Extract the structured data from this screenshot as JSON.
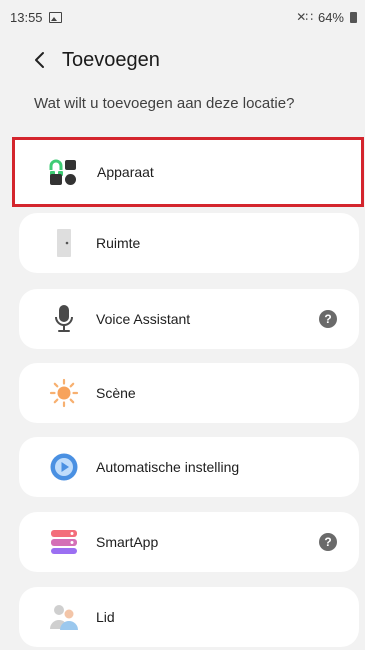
{
  "status_bar": {
    "time": "13:55",
    "signal": "✕∷",
    "battery": "64%"
  },
  "header": {
    "title": "Toevoegen"
  },
  "prompt": "Wat wilt u toevoegen aan deze locatie?",
  "items": [
    {
      "label": "Apparaat",
      "icon": "device-icon",
      "help": false,
      "selected": true
    },
    {
      "label": "Ruimte",
      "icon": "room-door-icon",
      "help": false
    },
    {
      "label": "Voice Assistant",
      "icon": "microphone-icon",
      "help": true
    },
    {
      "label": "Scène",
      "icon": "sun-scene-icon",
      "help": false
    },
    {
      "label": "Automatische instelling",
      "icon": "automation-play-icon",
      "help": false
    },
    {
      "label": "SmartApp",
      "icon": "smartapp-icon",
      "help": true
    },
    {
      "label": "Lid",
      "icon": "members-icon",
      "help": false
    }
  ],
  "help_glyph": "?",
  "colors": {
    "highlight_border": "#d4252d",
    "device_green": "#3ecb74",
    "sun_orange": "#f7a35c",
    "automation_blue": "#4a90e2",
    "smartapp_gradient": [
      "#f36e7b",
      "#9b6ff2"
    ]
  }
}
